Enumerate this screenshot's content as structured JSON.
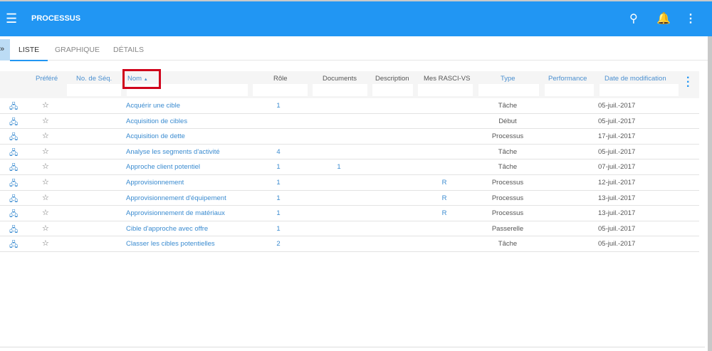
{
  "header": {
    "title": "PROCESSUS",
    "menu_icon": "hamburger-icon",
    "icons": [
      "search-icon",
      "bell-icon",
      "more-vert-icon"
    ]
  },
  "tabs": [
    {
      "label": "LISTE",
      "active": true
    },
    {
      "label": "GRAPHIQUE"
    },
    {
      "label": "DÉTAILS"
    }
  ],
  "columns": {
    "prefere": "Préféré",
    "seq": "No. de Séq.",
    "nom": "Nom",
    "role": "Rôle",
    "documents": "Documents",
    "description": "Description",
    "rasci": "Mes RASCI-VS",
    "type": "Type",
    "performance": "Performance",
    "date": "Date de modification"
  },
  "sort": {
    "column": "Nom",
    "direction": "ascending",
    "indicator": "▲"
  },
  "rows": [
    {
      "nom": "Acquérir une cible",
      "role": "1",
      "documents": "",
      "rasci": "",
      "type": "Tâche",
      "date": "05-juil.-2017"
    },
    {
      "nom": "Acquisition de cibles",
      "role": "",
      "documents": "",
      "rasci": "",
      "type": "Début",
      "date": "05-juil.-2017"
    },
    {
      "nom": "Acquisition de dette",
      "role": "",
      "documents": "",
      "rasci": "",
      "type": "Processus",
      "date": "17-juil.-2017"
    },
    {
      "nom": "Analyse les segments d'activité",
      "role": "4",
      "documents": "",
      "rasci": "",
      "type": "Tâche",
      "date": "05-juil.-2017"
    },
    {
      "nom": "Approche client potentiel",
      "role": "1",
      "documents": "1",
      "rasci": "",
      "type": "Tâche",
      "date": "07-juil.-2017"
    },
    {
      "nom": "Approvisionnement",
      "role": "1",
      "documents": "",
      "rasci": "R",
      "type": "Processus",
      "date": "12-juil.-2017"
    },
    {
      "nom": "Approvisionnement d'équipement",
      "role": "1",
      "documents": "",
      "rasci": "R",
      "type": "Processus",
      "date": "13-juil.-2017"
    },
    {
      "nom": "Approvisionnement de matériaux",
      "role": "1",
      "documents": "",
      "rasci": "R",
      "type": "Processus",
      "date": "13-juil.-2017"
    },
    {
      "nom": "Cible d'approche avec offre",
      "role": "1",
      "documents": "",
      "rasci": "",
      "type": "Passerelle",
      "date": "05-juil.-2017"
    },
    {
      "nom": "Classer les cibles potentielles",
      "role": "2",
      "documents": "",
      "rasci": "",
      "type": "Tâche",
      "date": "05-juil.-2017"
    }
  ]
}
